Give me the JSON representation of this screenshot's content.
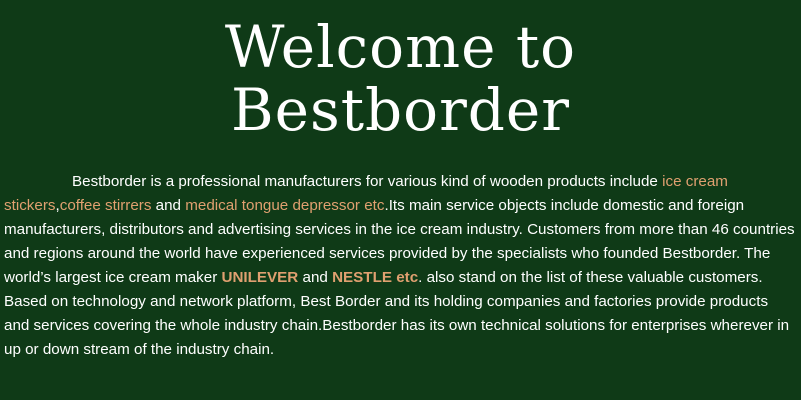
{
  "title": {
    "line1": "Welcome to",
    "line2": "Bestborder"
  },
  "intro": {
    "seg1": "Bestborder is a professional manufacturers for various kind of wooden products include ",
    "link_ice_cream": "ice cream stickers",
    "seg2": ",",
    "link_coffee": "coffee stirrers",
    "seg3": " and ",
    "link_medical": "medical tongue depressor etc",
    "seg4": ".Its main service objects include domestic and foreign manufacturers, distributors and advertising services in the ice cream industry. Customers from more than 46 countries and regions around the world have experienced services provided by the specialists who founded Bestborder. The world’s largest ice cream maker ",
    "brand_unilever": "UNILEVER",
    "seg5": " and ",
    "brand_nestle": "NESTLE etc",
    "seg6": ". also stand on the list of these valuable customers. Based on technology and network platform, Best Border and its holding companies and factories provide products and services covering the whole industry chain.Bestborder has its own technical solutions for enterprises wherever in up or down stream of the industry chain."
  },
  "colors": {
    "background": "#0f3a17",
    "text": "#ffffff",
    "highlight": "#e0a070"
  }
}
